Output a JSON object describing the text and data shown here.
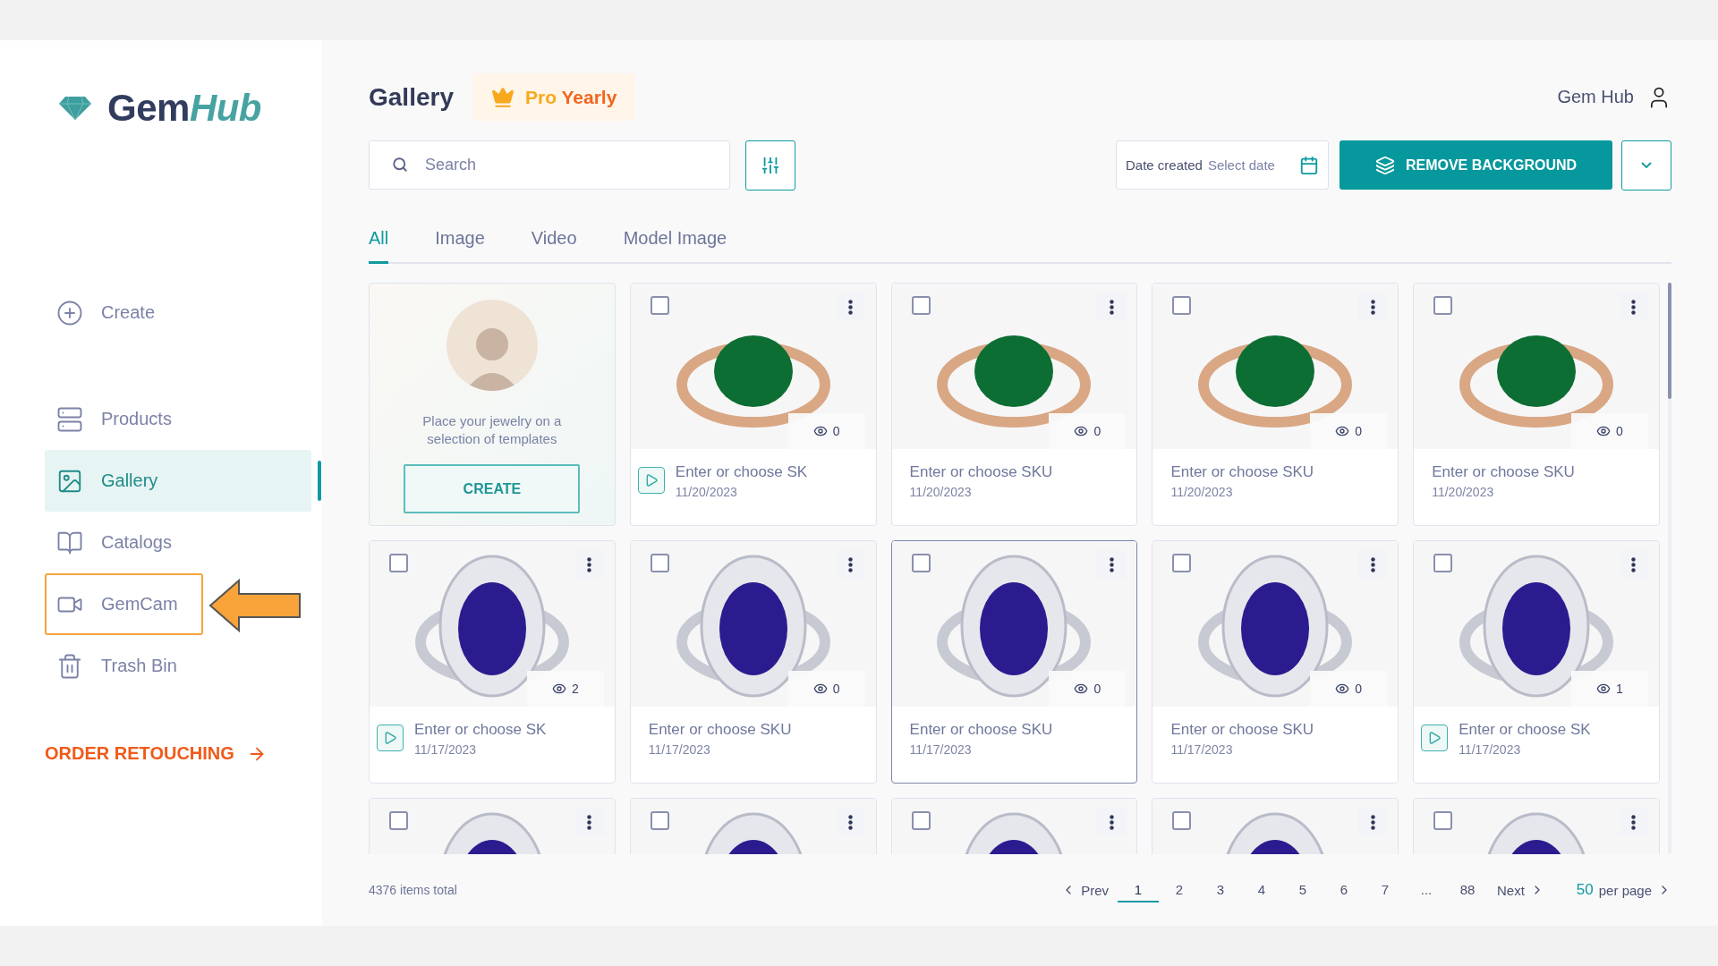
{
  "logo": {
    "primary": "Gem",
    "accent": "Hub"
  },
  "sidebar": {
    "create": {
      "label": "Create"
    },
    "items": [
      {
        "label": "Products",
        "selected": false,
        "highlighted": false
      },
      {
        "label": "Gallery",
        "selected": true,
        "highlighted": false
      },
      {
        "label": "Catalogs",
        "selected": false,
        "highlighted": false
      },
      {
        "label": "GemCam",
        "selected": false,
        "highlighted": true
      },
      {
        "label": "Trash Bin",
        "selected": false,
        "highlighted": false
      }
    ],
    "order_link": "ORDER RETOUCHING"
  },
  "header": {
    "title": "Gallery",
    "plan_badge": {
      "tier": "Pro",
      "period": "Yearly"
    },
    "user_name": "Gem Hub"
  },
  "toolbar": {
    "search": {
      "placeholder": "Search"
    },
    "date_filter": {
      "label": "Date created",
      "placeholder": "Select date"
    },
    "primary_button": "REMOVE BACKGROUND"
  },
  "tabs": [
    {
      "label": "All",
      "selected": true
    },
    {
      "label": "Image",
      "selected": false
    },
    {
      "label": "Video",
      "selected": false
    },
    {
      "label": "Model Image",
      "selected": false
    }
  ],
  "gallery": {
    "items": [
      {
        "kind": "template",
        "text": "Place your jewelry on a selection of templates",
        "button": "CREATE"
      },
      {
        "kind": "media",
        "checked": false,
        "selected": false,
        "video": true,
        "color": "#0d6e33",
        "views": "0",
        "title": "Enter or choose SK",
        "date": "11/20/2023"
      },
      {
        "kind": "media",
        "checked": false,
        "selected": false,
        "video": false,
        "color": "#0d6e33",
        "views": "0",
        "title": "Enter or choose SKU",
        "date": "11/20/2023"
      },
      {
        "kind": "media",
        "checked": false,
        "selected": false,
        "video": false,
        "color": "#0d6e33",
        "views": "0",
        "title": "Enter or choose SKU",
        "date": "11/20/2023"
      },
      {
        "kind": "media",
        "checked": false,
        "selected": false,
        "video": false,
        "color": "#0d6e33",
        "views": "0",
        "title": "Enter or choose SKU",
        "date": "11/20/2023"
      },
      {
        "kind": "media",
        "checked": false,
        "selected": false,
        "video": true,
        "color": "#2a1c8f",
        "views": "2",
        "title": "Enter or choose SK",
        "date": "11/17/2023"
      },
      {
        "kind": "media",
        "checked": false,
        "selected": false,
        "video": false,
        "color": "#2a1c8f",
        "views": "0",
        "title": "Enter or choose SKU",
        "date": "11/17/2023"
      },
      {
        "kind": "media",
        "checked": false,
        "selected": true,
        "video": false,
        "color": "#2a1c8f",
        "views": "0",
        "title": "Enter or choose SKU",
        "date": "11/17/2023"
      },
      {
        "kind": "media",
        "checked": false,
        "selected": false,
        "video": false,
        "color": "#2a1c8f",
        "views": "0",
        "title": "Enter or choose SKU",
        "date": "11/17/2023"
      },
      {
        "kind": "media",
        "checked": false,
        "selected": false,
        "video": true,
        "color": "#2a1c8f",
        "views": "1",
        "title": "Enter or choose SK",
        "date": "11/17/2023"
      },
      {
        "kind": "media",
        "checked": false,
        "selected": false,
        "color": "#2a1c8f"
      },
      {
        "kind": "media",
        "checked": false,
        "selected": false,
        "color": "#2a1c8f"
      },
      {
        "kind": "media",
        "checked": false,
        "selected": false,
        "color": "#2a1c8f"
      },
      {
        "kind": "media",
        "checked": false,
        "selected": false,
        "color": "#2a1c8f"
      },
      {
        "kind": "media",
        "checked": false,
        "selected": false,
        "color": "#2a1c8f"
      }
    ]
  },
  "footer": {
    "total": "4376 items total",
    "prev": "Prev",
    "next": "Next",
    "pages": [
      {
        "label": "1",
        "selected": true
      },
      {
        "label": "2",
        "selected": false
      },
      {
        "label": "3",
        "selected": false
      },
      {
        "label": "4",
        "selected": false
      },
      {
        "label": "5",
        "selected": false
      },
      {
        "label": "6",
        "selected": false
      },
      {
        "label": "7",
        "selected": false
      },
      {
        "label": "...",
        "selected": false
      },
      {
        "label": "88",
        "selected": false
      }
    ],
    "page_size": "50",
    "page_size_label": "per page"
  }
}
